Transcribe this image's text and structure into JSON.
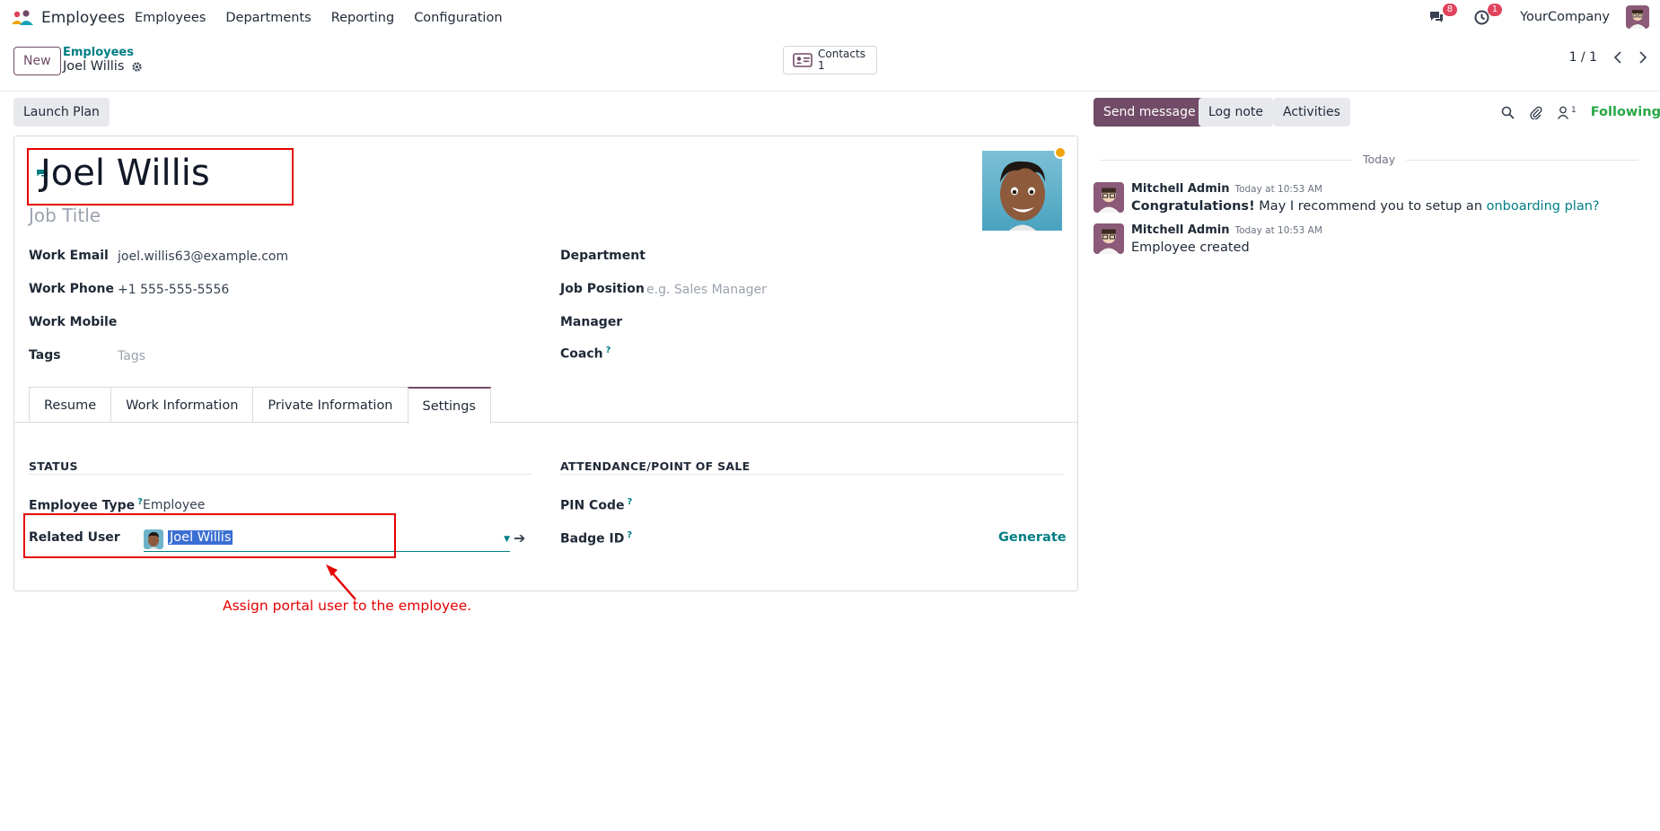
{
  "nav": {
    "app_name": "Employees",
    "menu": [
      "Employees",
      "Departments",
      "Reporting",
      "Configuration"
    ],
    "messages_badge": "8",
    "activities_badge": "1",
    "company": "YourCompany"
  },
  "control": {
    "new_label": "New",
    "breadcrumb_parent": "Employees",
    "breadcrumb_current": "Joel Willis",
    "contacts_label": "Contacts",
    "contacts_count": "1",
    "pager": "1 / 1"
  },
  "actions": {
    "launch_plan": "Launch Plan",
    "send_message": "Send message",
    "log_note": "Log note",
    "activities": "Activities",
    "followers_count": "1",
    "following": "Following"
  },
  "employee": {
    "name": "Joel Willis",
    "job_title_placeholder": "Job Title",
    "fields_left": [
      {
        "label": "Work Email",
        "value": "joel.willis63@example.com",
        "placeholder": ""
      },
      {
        "label": "Work Phone",
        "value": "+1 555-555-5556",
        "placeholder": ""
      },
      {
        "label": "Work Mobile",
        "value": "",
        "placeholder": ""
      },
      {
        "label": "Tags",
        "value": "",
        "placeholder": "Tags"
      }
    ],
    "fields_right": [
      {
        "label": "Department",
        "value": "",
        "placeholder": ""
      },
      {
        "label": "Job Position",
        "value": "",
        "placeholder": "e.g. Sales Manager"
      },
      {
        "label": "Manager",
        "value": "",
        "placeholder": ""
      },
      {
        "label": "Coach",
        "value": "",
        "placeholder": ""
      }
    ],
    "help_mark": "?"
  },
  "tabs": [
    "Resume",
    "Work Information",
    "Private Information",
    "Settings"
  ],
  "settings": {
    "status_title": "STATUS",
    "attendance_title": "ATTENDANCE/POINT OF SALE",
    "employee_type_label": "Employee Type",
    "employee_type_value": "Employee",
    "related_user_label": "Related User",
    "related_user_value": "Joel Willis",
    "pin_label": "PIN Code",
    "badge_label": "Badge ID",
    "generate": "Generate"
  },
  "annotation": "Assign portal user to the employee.",
  "chatter": {
    "date_separator": "Today",
    "messages": [
      {
        "author": "Mitchell Admin",
        "time": "Today at 10:53 AM",
        "bold": "Congratulations!",
        "text": " May I recommend you to setup an ",
        "link": "onboarding plan?"
      },
      {
        "author": "Mitchell Admin",
        "time": "Today at 10:53 AM",
        "bold": "",
        "text": "Employee created",
        "link": ""
      }
    ]
  },
  "colors": {
    "brand": "#714b67",
    "accent": "#017e84",
    "annotation": "#e50000",
    "following": "#28a745"
  }
}
